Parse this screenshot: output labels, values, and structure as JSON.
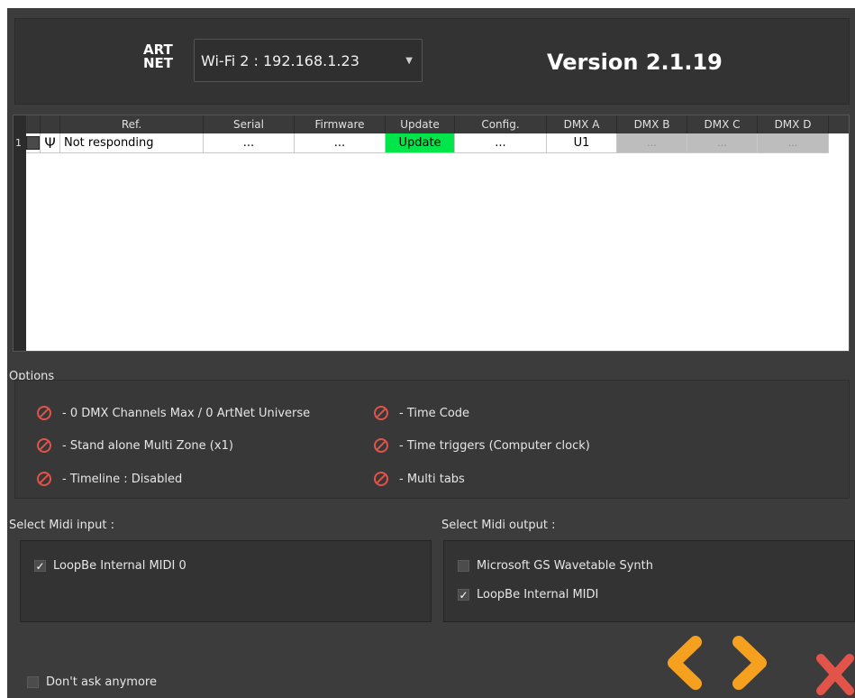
{
  "header": {
    "logo_line1": "ART",
    "logo_line2": "NET",
    "network_selected": "Wi-Fi 2 : 192.168.1.23",
    "version": "Version 2.1.19"
  },
  "table": {
    "columns": [
      "Ref.",
      "Serial",
      "Firmware",
      "Update",
      "Config.",
      "DMX A",
      "DMX B",
      "DMX C",
      "DMX D"
    ],
    "rows": [
      {
        "num": "1",
        "ref": "Not responding",
        "serial": "...",
        "firmware": "...",
        "update": "Update",
        "config": "...",
        "dmx_a": "U1",
        "dmx_b": "...",
        "dmx_c": "...",
        "dmx_d": "..."
      }
    ]
  },
  "options": {
    "title": "Options",
    "items": [
      "- 0 DMX Channels Max / 0 ArtNet Universe",
      "- Stand alone Multi Zone (x1)",
      "- Timeline : Disabled",
      "- Time Code",
      "- Time triggers (Computer clock)",
      "- Multi tabs"
    ]
  },
  "midi_input": {
    "title": "Select Midi input :",
    "items": [
      {
        "label": "LoopBe Internal MIDI 0",
        "checked": true
      }
    ]
  },
  "midi_output": {
    "title": "Select Midi output :",
    "items": [
      {
        "label": "Microsoft GS Wavetable Synth",
        "checked": false
      },
      {
        "label": "LoopBe Internal MIDI",
        "checked": true
      }
    ]
  },
  "footer": {
    "dont_ask": "Don't ask anymore",
    "check_mark": "✓"
  },
  "colors": {
    "accent_orange": "#f5a11f",
    "close_red": "#e2534a",
    "update_green": "#00e64a"
  }
}
